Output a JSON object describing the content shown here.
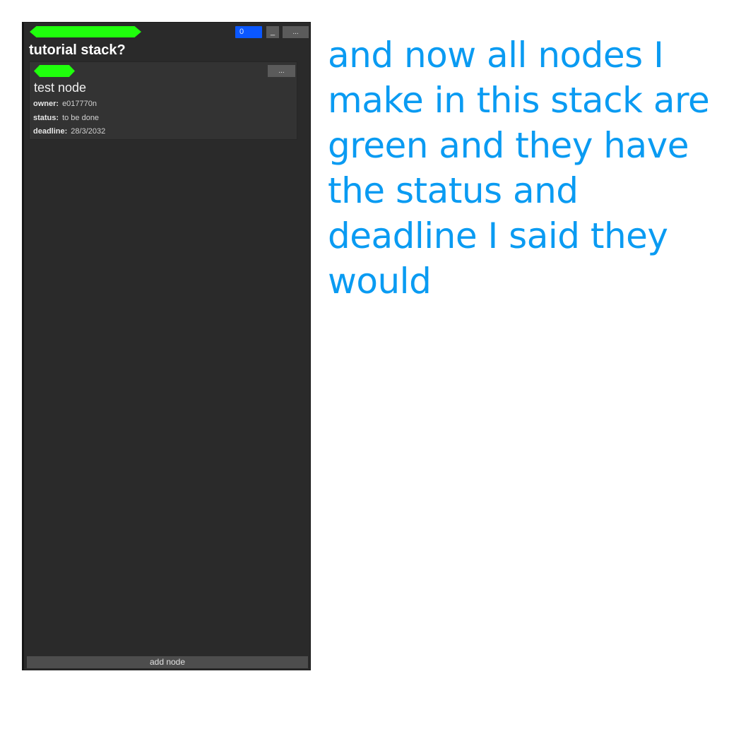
{
  "stack": {
    "color": "#1fff0c",
    "title": "tutorial stack?",
    "count": "0",
    "minimize_label": "_",
    "menu_label": "...",
    "add_node_label": "add node"
  },
  "node": {
    "color": "#1fff0c",
    "menu_label": "...",
    "title": "test node",
    "fields": {
      "owner_label": "owner:",
      "owner_value": "e017770n",
      "status_label": "status:",
      "status_value": "to be done",
      "deadline_label": "deadline:",
      "deadline_value": "28/3/2032"
    }
  },
  "caption": {
    "text": "and now all nodes I make in this stack are green and they have the status and deadline I said they would",
    "color": "#0a9bf2"
  }
}
